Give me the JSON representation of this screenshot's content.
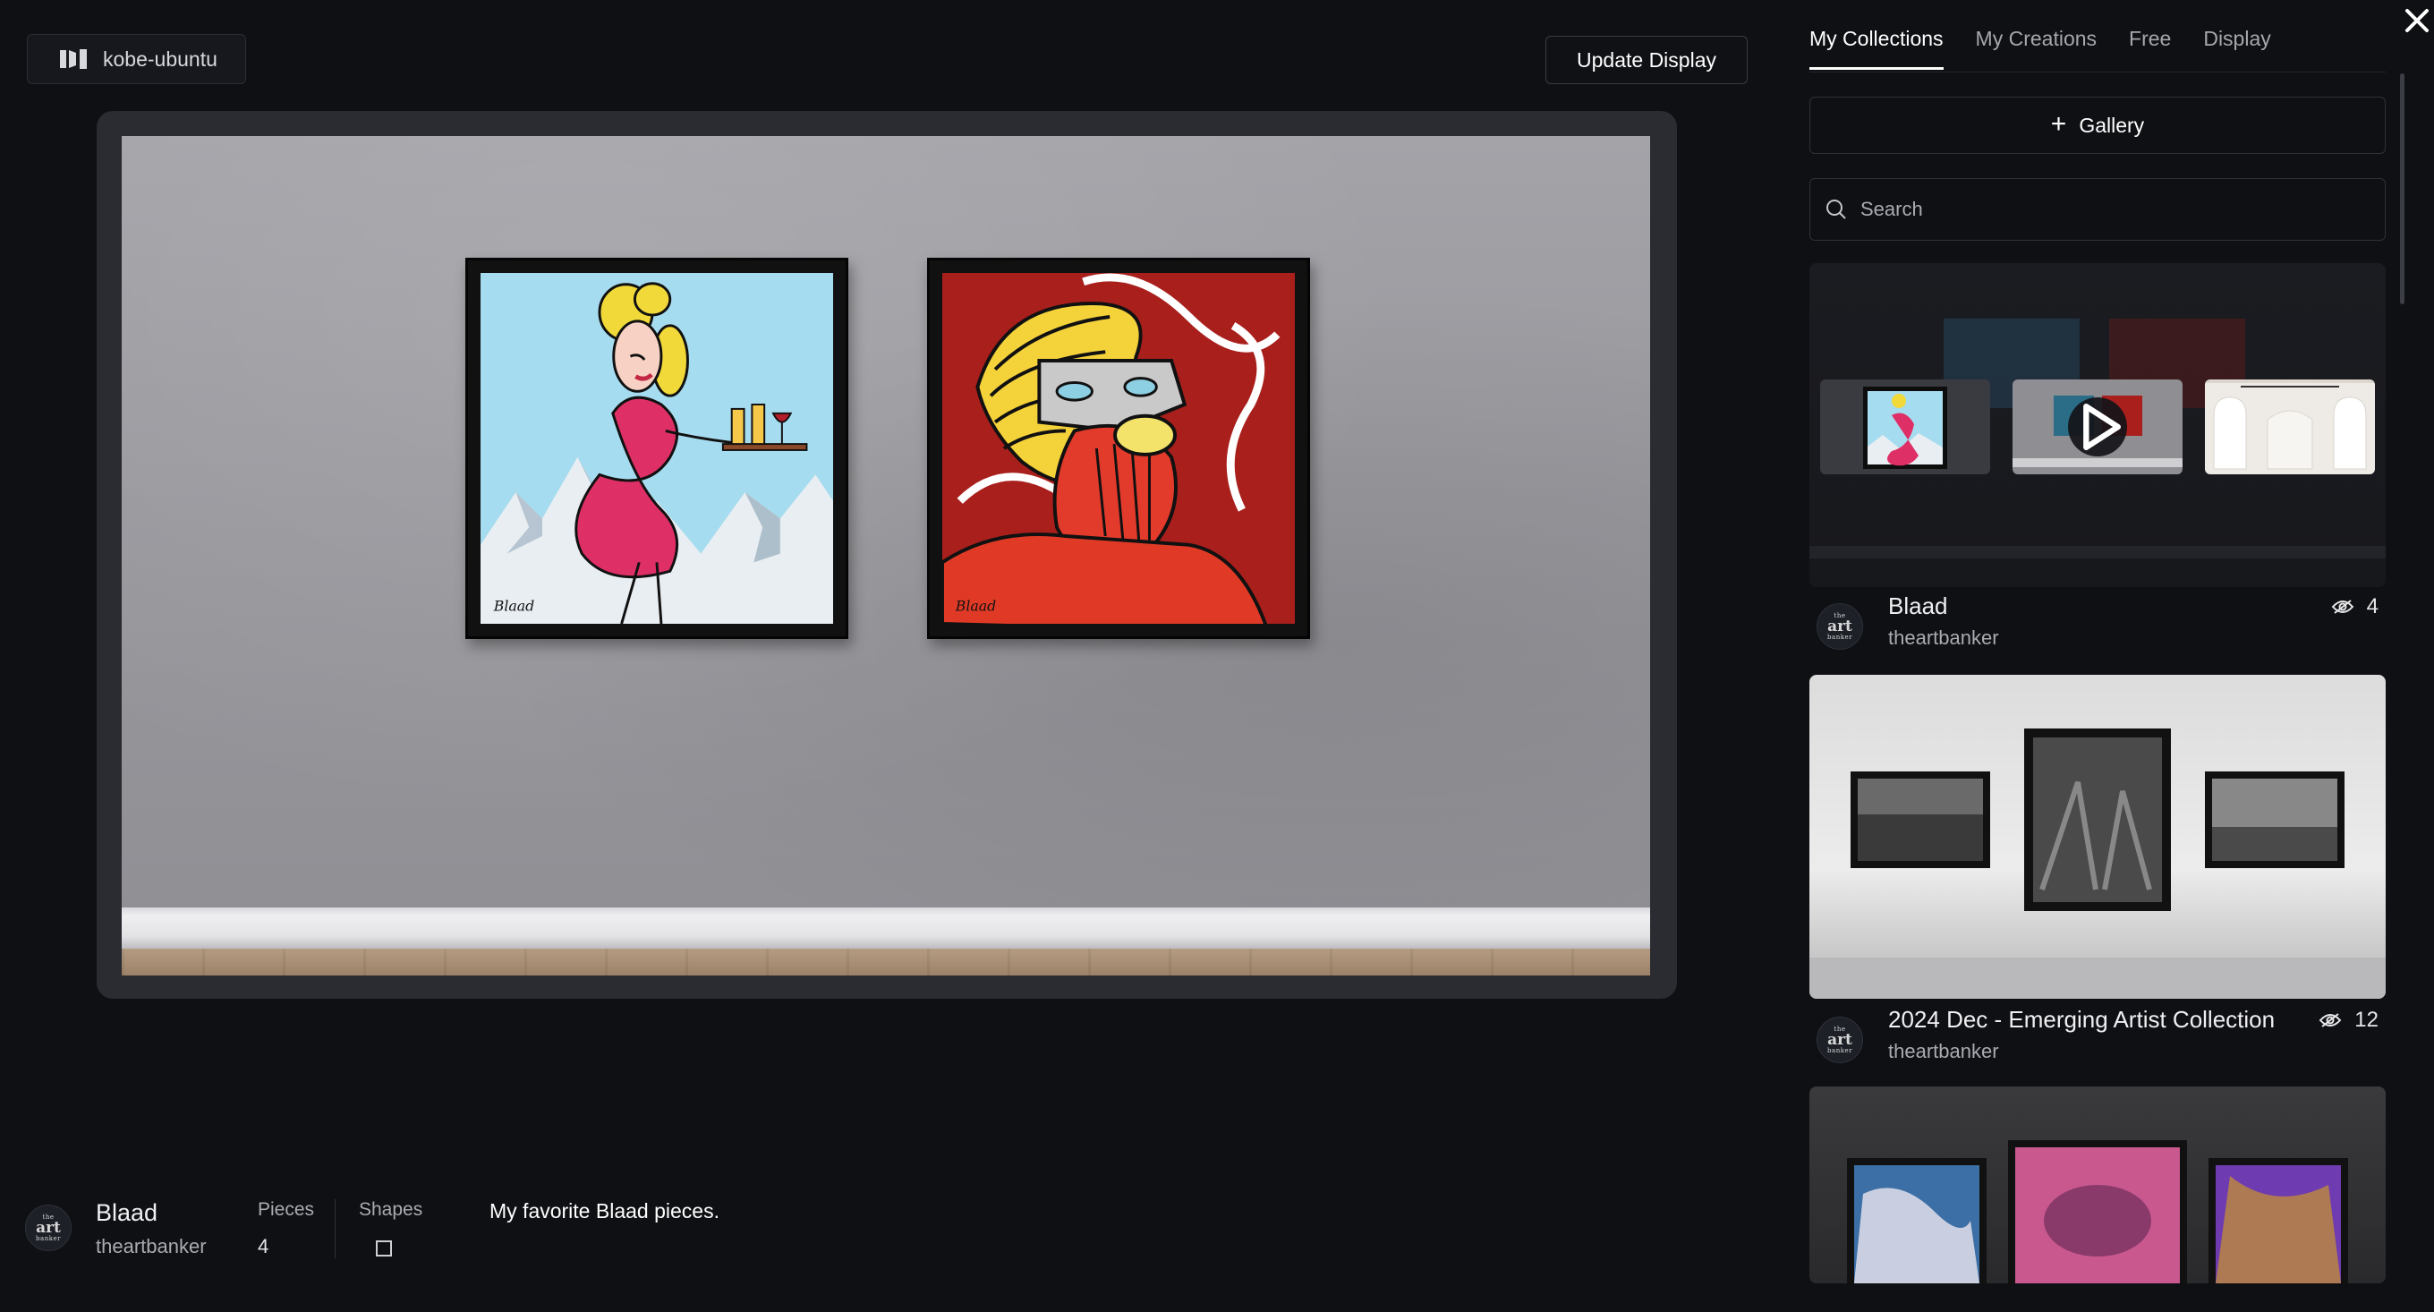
{
  "device": {
    "name": "kobe-ubuntu",
    "icon": "display-device-icon"
  },
  "toolbar": {
    "update_label": "Update Display"
  },
  "preview": {
    "artworks": [
      {
        "name": "woman-with-drinks-artwork",
        "signature": "Blaad"
      },
      {
        "name": "bearded-man-artwork",
        "signature": "Blaad"
      }
    ]
  },
  "info": {
    "avatar_small": "the",
    "avatar_big": "art",
    "avatar_small2": "banker",
    "title": "Blaad",
    "owner": "theartbanker",
    "pieces_label": "Pieces",
    "pieces_value": "4",
    "shapes_label": "Shapes",
    "shapes_icon": "square-shape-icon",
    "description": "My favorite Blaad pieces."
  },
  "panel": {
    "tabs": [
      "My Collections",
      "My Creations",
      "Free",
      "Display"
    ],
    "active_tab": "My Collections",
    "gallery_label": "Gallery",
    "search_placeholder": "Search",
    "collections": [
      {
        "title": "Blaad",
        "owner": "theartbanker",
        "views": "4"
      },
      {
        "title": "2024 Dec - Emerging Artist Collection",
        "owner": "theartbanker",
        "views": "12"
      }
    ]
  },
  "colors": {
    "background": "#0f1014",
    "accent": "#ffffff",
    "muted_text": "#a9abb1"
  }
}
